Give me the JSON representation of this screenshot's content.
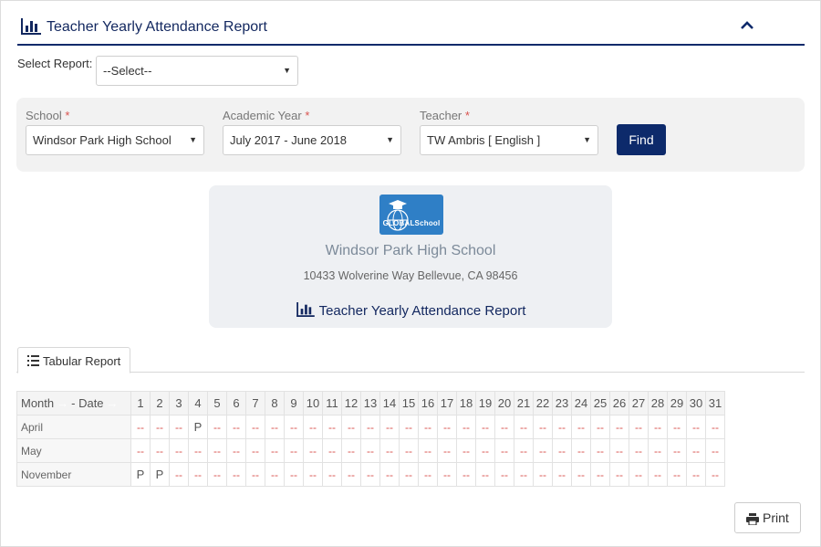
{
  "header": {
    "title": "Teacher Yearly Attendance Report",
    "collapse_icon": "chevron-up-icon",
    "accent_color": "#0d2a6b"
  },
  "select_report": {
    "label": "Select Report:",
    "value": "--Select--"
  },
  "filters": {
    "school": {
      "label": "School",
      "required": "*",
      "value": "Windsor Park High School"
    },
    "academic_year": {
      "label": "Academic Year",
      "required": "*",
      "value": "July 2017 - June 2018"
    },
    "teacher": {
      "label": "Teacher",
      "required": "*",
      "value": "TW Ambris [ English ]"
    },
    "find_label": "Find"
  },
  "report_card": {
    "logo_text": "GLOBALSchool",
    "school_name": "Windsor Park High School",
    "address": "10433 Wolverine Way Bellevue, CA 98456",
    "report_title": "Teacher Yearly Attendance Report"
  },
  "tabs": [
    {
      "label": "Tabular Report",
      "icon": "list-icon",
      "active": true
    }
  ],
  "table": {
    "month_header": "Month",
    "date_header": "- Date",
    "days": [
      "1",
      "2",
      "3",
      "4",
      "5",
      "6",
      "7",
      "8",
      "9",
      "10",
      "11",
      "12",
      "13",
      "14",
      "15",
      "16",
      "17",
      "18",
      "19",
      "20",
      "21",
      "22",
      "23",
      "24",
      "25",
      "26",
      "27",
      "28",
      "29",
      "30",
      "31"
    ],
    "rows": [
      {
        "month": "April",
        "values": [
          "--",
          "--",
          "--",
          "P",
          "--",
          "--",
          "--",
          "--",
          "--",
          "--",
          "--",
          "--",
          "--",
          "--",
          "--",
          "--",
          "--",
          "--",
          "--",
          "--",
          "--",
          "--",
          "--",
          "--",
          "--",
          "--",
          "--",
          "--",
          "--",
          "--",
          "--"
        ]
      },
      {
        "month": "May",
        "values": [
          "--",
          "--",
          "--",
          "--",
          "--",
          "--",
          "--",
          "--",
          "--",
          "--",
          "--",
          "--",
          "--",
          "--",
          "--",
          "--",
          "--",
          "--",
          "--",
          "--",
          "--",
          "--",
          "--",
          "--",
          "--",
          "--",
          "--",
          "--",
          "--",
          "--",
          "--"
        ]
      },
      {
        "month": "November",
        "values": [
          "P",
          "P",
          "--",
          "--",
          "--",
          "--",
          "--",
          "--",
          "--",
          "--",
          "--",
          "--",
          "--",
          "--",
          "--",
          "--",
          "--",
          "--",
          "--",
          "--",
          "--",
          "--",
          "--",
          "--",
          "--",
          "--",
          "--",
          "--",
          "--",
          "--",
          "--"
        ]
      }
    ],
    "absent_color": "#d9534f"
  },
  "print_label": "Print"
}
